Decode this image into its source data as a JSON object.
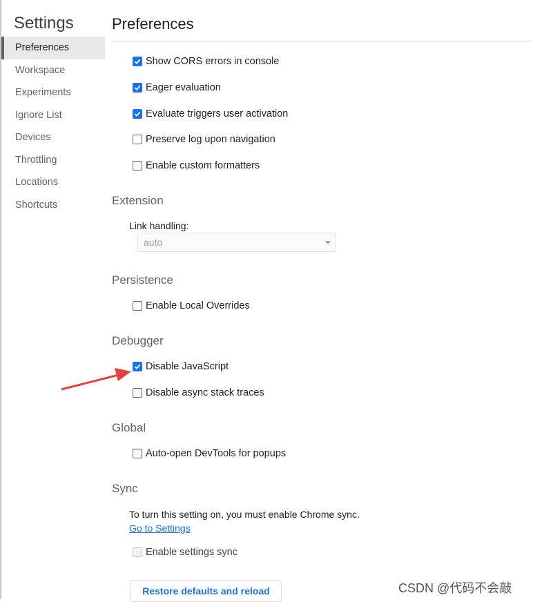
{
  "sidebar": {
    "title": "Settings",
    "items": [
      {
        "label": "Preferences"
      },
      {
        "label": "Workspace"
      },
      {
        "label": "Experiments"
      },
      {
        "label": "Ignore List"
      },
      {
        "label": "Devices"
      },
      {
        "label": "Throttling"
      },
      {
        "label": "Locations"
      },
      {
        "label": "Shortcuts"
      }
    ],
    "selected": "Preferences"
  },
  "main": {
    "title": "Preferences",
    "console_options": [
      {
        "label": "Show CORS errors in console",
        "checked": true
      },
      {
        "label": "Eager evaluation",
        "checked": true
      },
      {
        "label": "Evaluate triggers user activation",
        "checked": true
      },
      {
        "label": "Preserve log upon navigation",
        "checked": false
      },
      {
        "label": "Enable custom formatters",
        "checked": false
      }
    ],
    "extension": {
      "title": "Extension",
      "link_handling_label": "Link handling:",
      "link_handling_value": "auto"
    },
    "persistence": {
      "title": "Persistence",
      "options": [
        {
          "label": "Enable Local Overrides",
          "checked": false
        }
      ]
    },
    "debugger": {
      "title": "Debugger",
      "options": [
        {
          "label": "Disable JavaScript",
          "checked": true
        },
        {
          "label": "Disable async stack traces",
          "checked": false
        }
      ]
    },
    "global": {
      "title": "Global",
      "options": [
        {
          "label": "Auto-open DevTools for popups",
          "checked": false
        }
      ]
    },
    "sync": {
      "title": "Sync",
      "text": "To turn this setting on, you must enable Chrome sync.",
      "link": "Go to Settings",
      "option": {
        "label": "Enable settings sync",
        "checked": false,
        "disabled": true
      }
    },
    "restore_button": "Restore defaults and reload"
  },
  "annotation": {
    "color": "#e8403a"
  },
  "watermark": "CSDN @代码不会敲",
  "colors": {
    "accent": "#1a73e8",
    "selected_bg": "#e8e8e8"
  }
}
